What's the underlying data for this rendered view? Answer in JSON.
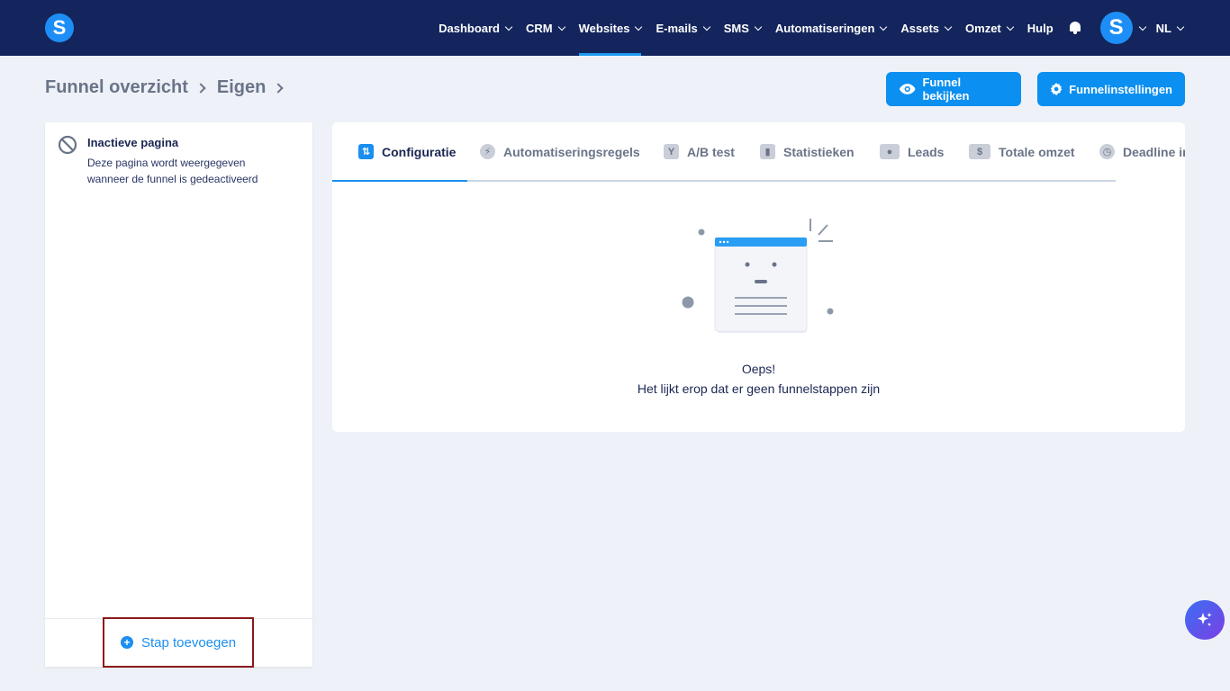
{
  "nav": {
    "logo": "S",
    "items": [
      {
        "label": "Dashboard"
      },
      {
        "label": "CRM"
      },
      {
        "label": "Websites"
      },
      {
        "label": "E-mails"
      },
      {
        "label": "SMS"
      },
      {
        "label": "Automatiseringen"
      },
      {
        "label": "Assets"
      },
      {
        "label": "Omzet"
      }
    ],
    "help": "Hulp",
    "avatar": "S",
    "language": "NL",
    "active_item": "Websites"
  },
  "breadcrumb": {
    "items": [
      "Funnel overzicht",
      "Eigen"
    ]
  },
  "header": {
    "view_button": "Funnel bekijken",
    "settings_button": "Funnelinstellingen"
  },
  "left_panel": {
    "inactive_title": "Inactieve pagina",
    "inactive_desc": "Deze pagina wordt weergegeven wanneer de funnel is gedeactiveerd",
    "add_step": "Stap toevoegen"
  },
  "tabs": [
    {
      "label": "Configuratie",
      "icon": "sliders-icon",
      "glyph": "⇅"
    },
    {
      "label": "Automatiseringsregels",
      "icon": "bolt-icon",
      "glyph": "⚡"
    },
    {
      "label": "A/B test",
      "icon": "split-icon",
      "glyph": "Y"
    },
    {
      "label": "Statistieken",
      "icon": "bar-chart-icon",
      "glyph": "▮"
    },
    {
      "label": "Leads",
      "icon": "users-icon",
      "glyph": "●"
    },
    {
      "label": "Totale omzet",
      "icon": "dollar-icon",
      "glyph": "$"
    },
    {
      "label": "Deadline in",
      "icon": "clock-icon",
      "glyph": "◷"
    }
  ],
  "empty_state": {
    "title": "Oeps!",
    "subtitle": "Het lijkt erop dat er geen funnelstappen zijn"
  },
  "colors": {
    "nav_bg": "#13255c",
    "accent": "#0b8ff0",
    "page_bg": "#eef2f8",
    "highlight_border": "#8b1a1a"
  }
}
